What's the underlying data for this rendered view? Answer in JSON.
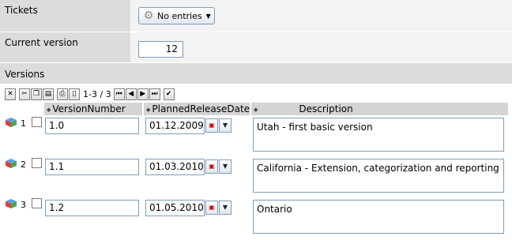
{
  "tickets": {
    "label": "Tickets",
    "dropdown_label": "No entries"
  },
  "current_version": {
    "label": "Current version",
    "value": "12"
  },
  "versions": {
    "label": "Versions",
    "pager_text": "1-3 / 3",
    "columns": {
      "version_number": "VersionNumber",
      "planned_release_date": "PlannedReleaseDate",
      "description": "Description"
    },
    "rows": [
      {
        "num": "1",
        "version": "1.0",
        "date": "01.12.2009",
        "description": "Utah - first basic version"
      },
      {
        "num": "2",
        "version": "1.1",
        "date": "01.03.2010",
        "description": "California - Extension, categorization and reporting"
      },
      {
        "num": "3",
        "version": "1.2",
        "date": "01.05.2010",
        "description": "Ontario"
      }
    ]
  }
}
